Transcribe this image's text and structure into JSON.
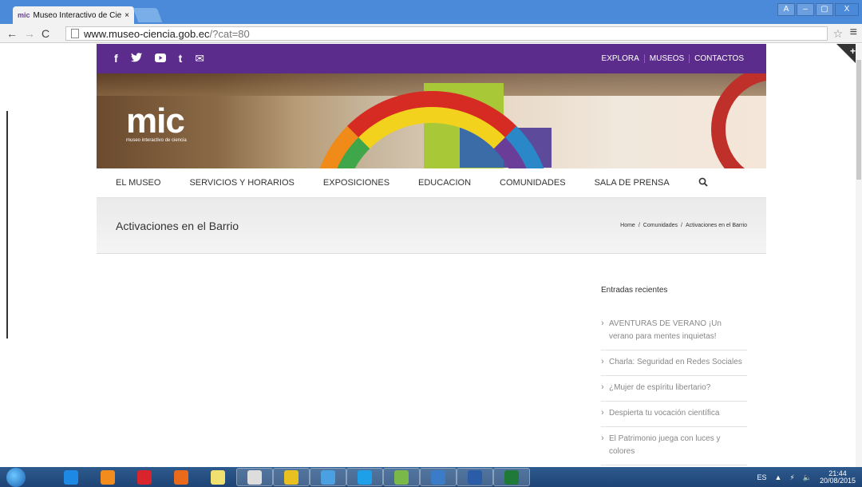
{
  "browser": {
    "tab_title": "Museo Interactivo de Cier",
    "tab_favicon": "mic",
    "tab_close": "×",
    "url_host": "www.museo-ciencia.gob.ec",
    "url_path": "/?cat=80",
    "window_buttons": [
      "A",
      "–",
      "▢",
      "X"
    ]
  },
  "site": {
    "social_icons": [
      "f",
      "t",
      "▶",
      "t",
      "✉"
    ],
    "top_nav": [
      "EXPLORA",
      "MUSEOS",
      "CONTACTOS"
    ],
    "logo_big": "mic",
    "logo_small": "museo interactivo de ciencia",
    "main_nav": [
      "EL MUSEO",
      "SERVICIOS Y HORARIOS",
      "EXPOSICIONES",
      "EDUCACION",
      "COMUNIDADES",
      "SALA DE PRENSA"
    ],
    "search_icon": "⚲",
    "page_title": "Activaciones en el Barrio",
    "breadcrumb": {
      "home": "Home",
      "sep": "/",
      "section": "Comunidades",
      "current": "Activaciones en el Barrio"
    }
  },
  "sidebar": {
    "heading": "Entradas recientes",
    "posts": [
      "AVENTURAS DE VERANO ¡Un verano para mentes inquietas!",
      "Charla: Seguridad en Redes Sociales",
      "¿Mujer de espíritu libertario?",
      "Despierta tu vocación científica",
      "El Patrimonio juega con luces y colores"
    ]
  },
  "taskbar": {
    "language": "ES",
    "time": "21:44",
    "date": "20/08/2015",
    "apps": [
      "ie-icon",
      "media-player-icon",
      "pin-icon",
      "firefox-icon",
      "notes-icon",
      "clock-icon",
      "chrome-icon",
      "app-icon",
      "skype-icon",
      "people-icon",
      "mail-icon",
      "word-icon",
      "excel-icon"
    ],
    "app_colors": [
      "#1e88e5",
      "#f28c1e",
      "#d8242a",
      "#e86a1a",
      "#f0e070",
      "#dddddd",
      "#e8c020",
      "#4aa0e0",
      "#1ea0e8",
      "#7ab84a",
      "#3a7cc8",
      "#2a5ca8",
      "#1f7a3a"
    ]
  }
}
